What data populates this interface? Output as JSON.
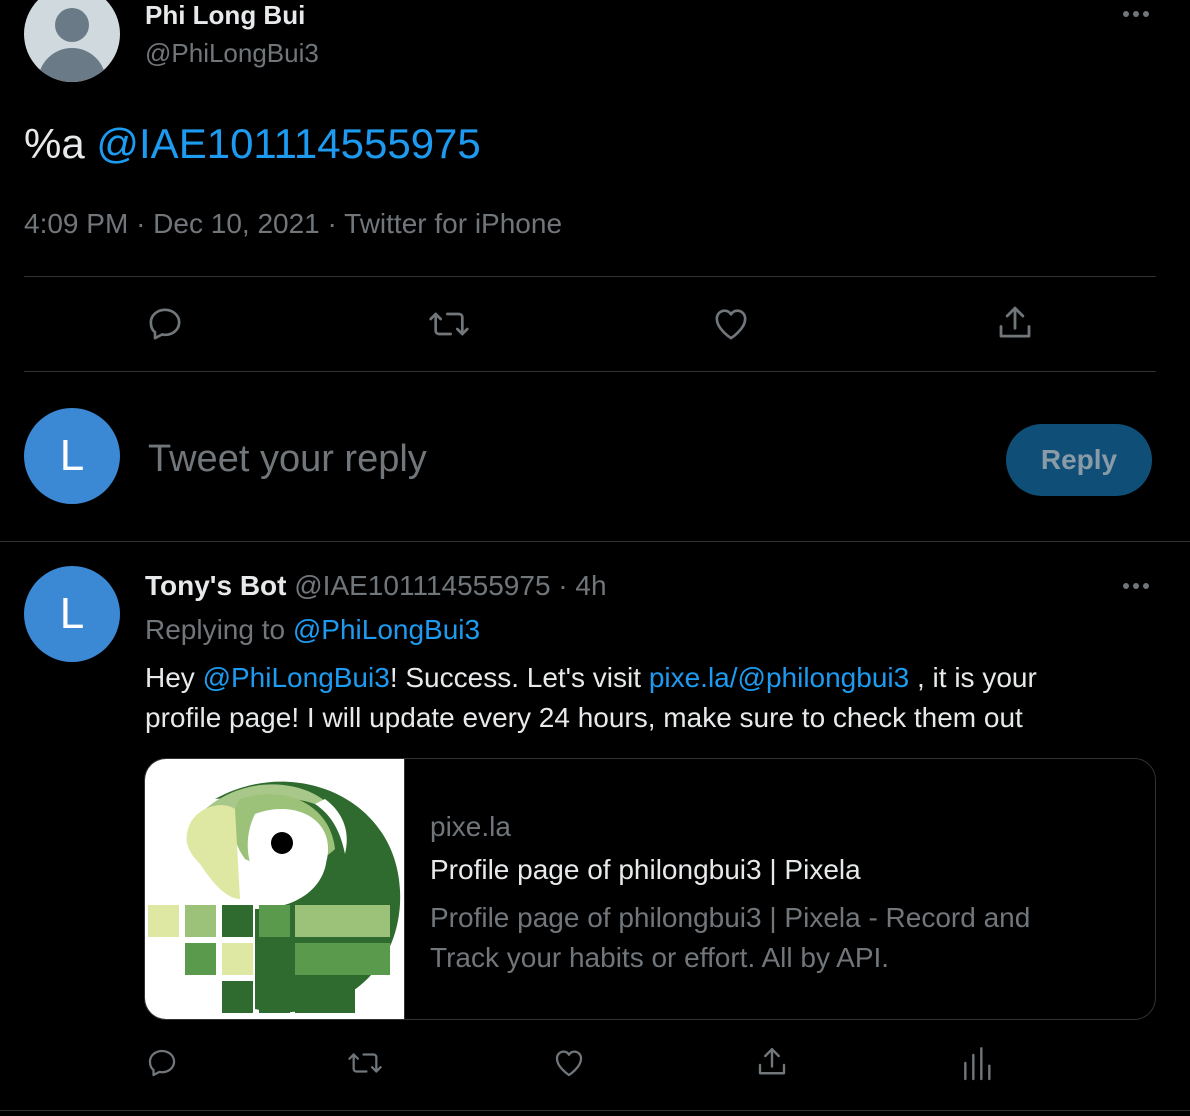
{
  "main_tweet": {
    "author_name": "Phi Long Bui",
    "author_handle": "@PhiLongBui3",
    "more_icon": "more-horizontal-icon",
    "text_prefix": "%a",
    "text_mention": "@IAE101114555975",
    "time": "4:09 PM",
    "date": "Dec 10, 2021",
    "source": "Twitter for iPhone",
    "separator": "·"
  },
  "actions": {
    "icons": [
      "reply-icon",
      "retweet-icon",
      "like-icon",
      "share-icon"
    ]
  },
  "reply_composer": {
    "avatar_letter": "L",
    "placeholder": "Tweet your reply",
    "button_label": "Reply"
  },
  "reply_tweet": {
    "avatar_letter": "L",
    "author_name": "Tony's Bot",
    "author_handle": "@IAE101114555975",
    "time_ago": "4h",
    "separator": "·",
    "replying_label": "Replying to",
    "replying_to": "@PhiLongBui3",
    "text_hey": "Hey",
    "text_mention": "@PhiLongBui3",
    "text_mid": "! Success. Let's visit",
    "text_link": "pixe.la/@philongbui3",
    "text_end": ", it is your",
    "text_line2": "profile page! I will update every 24 hours, make sure to check them out",
    "card": {
      "domain": "pixe.la",
      "title": "Profile page of philongbui3 | Pixela",
      "desc_line1": "Profile page of philongbui3 | Pixela - Record and",
      "desc_line2": "Track your habits or effort. All by API."
    },
    "action_icons": [
      "reply-icon",
      "retweet-icon",
      "like-icon",
      "share-icon",
      "analytics-icon"
    ]
  },
  "colors": {
    "background": "#000000",
    "text": "#e7e9ea",
    "muted": "#71767b",
    "link": "#1d9bf0",
    "reply_button": "#0f4e76",
    "avatar_blue": "#3b88d4"
  }
}
